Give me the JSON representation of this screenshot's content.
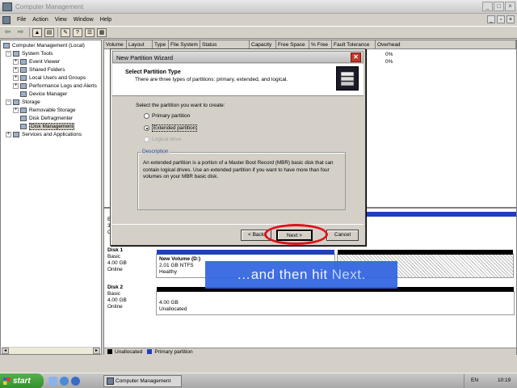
{
  "window": {
    "title": "Computer Management"
  },
  "menu": {
    "items": [
      "File",
      "Action",
      "View",
      "Window",
      "Help"
    ]
  },
  "tree": {
    "items": [
      {
        "label": "Computer Management (Local)",
        "level": 0
      },
      {
        "label": "System Tools",
        "level": 1
      },
      {
        "label": "Event Viewer",
        "level": 2
      },
      {
        "label": "Shared Folders",
        "level": 2
      },
      {
        "label": "Local Users and Groups",
        "level": 2
      },
      {
        "label": "Performance Logs and Alerts",
        "level": 2
      },
      {
        "label": "Device Manager",
        "level": 2
      },
      {
        "label": "Storage",
        "level": 1
      },
      {
        "label": "Removable Storage",
        "level": 2
      },
      {
        "label": "Disk Defragmenter",
        "level": 2
      },
      {
        "label": "Disk Management",
        "level": 2,
        "selected": true
      },
      {
        "label": "Services and Applications",
        "level": 1
      }
    ]
  },
  "volume_list": {
    "columns": [
      "Volume",
      "Layout",
      "Type",
      "File System",
      "Status",
      "Capacity",
      "Free Space",
      "% Free",
      "Fault Tolerance",
      "Overhead"
    ],
    "overhead_values": [
      "0%",
      "0%"
    ]
  },
  "disks": [
    {
      "name": "Disk 1",
      "type": "Basic",
      "size": "4.00 GB",
      "status": "Online",
      "partition": {
        "name": "New Volume  (D:)",
        "detail": "2.01 GB NTFS",
        "status": "Healthy"
      }
    },
    {
      "name": "Disk 2",
      "type": "Basic",
      "size": "4.00 GB",
      "status": "Online",
      "partition": {
        "detail": "4.00 GB",
        "status": "Unallocated"
      }
    }
  ],
  "legend": {
    "unallocated": "Unallocated",
    "primary": "Primary partition"
  },
  "wizard": {
    "title": "New Partition Wizard",
    "heading": "Select Partition Type",
    "subheading": "There are three types of partitions: primary, extended, and logical.",
    "prompt": "Select the partition you want to create:",
    "options": [
      "Primary partition",
      "Extended partition",
      "Logical drive"
    ],
    "selected_option": "Extended partition",
    "description_title": "Description",
    "description": "An extended partition is a portion of a Master Boot Record (MBR) basic disk that can contain logical drives. Use an extended partition if you want to have more than four volumes on your MBR basic disk.",
    "back_label": "< Back",
    "next_label": "Next >",
    "cancel_label": "Cancel"
  },
  "caption": {
    "part1": "…and then hit",
    "part2": "Next."
  },
  "taskbar": {
    "start_label": "start",
    "task_label": "Computer Management",
    "language": "EN",
    "clock": "10:19"
  },
  "colors": {
    "caption_bg": "#2f63e0",
    "highlight_ring": "#e0101a",
    "start_green": "#3a9a33",
    "close_red": "#c0392b",
    "primary_partition": "#1f3fbf"
  }
}
